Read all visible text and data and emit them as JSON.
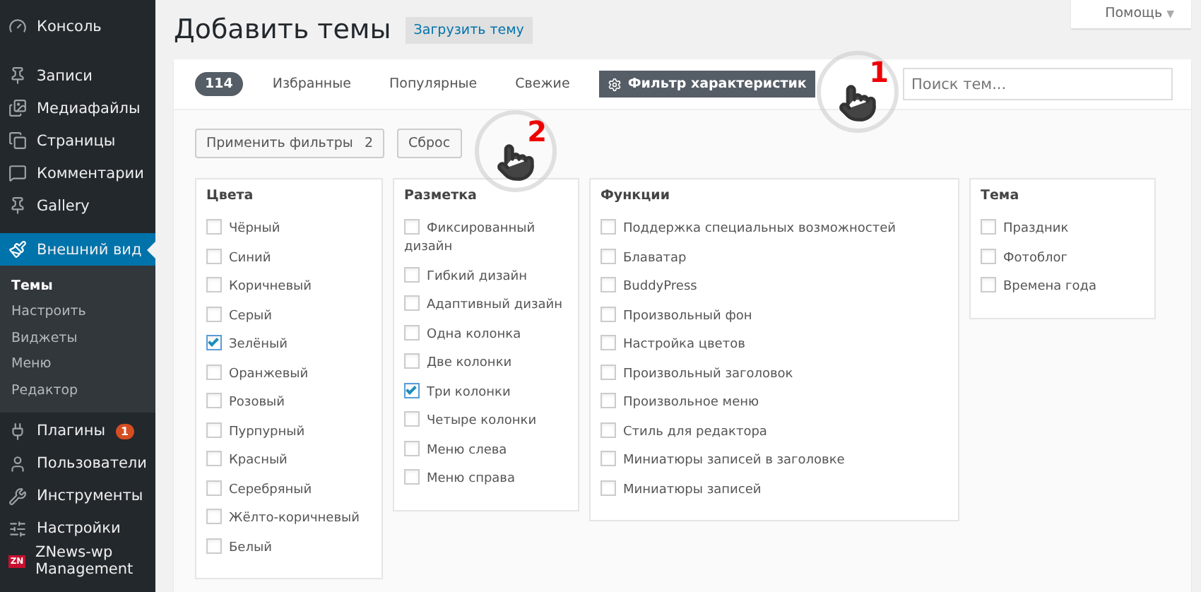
{
  "sidebar": {
    "items": [
      {
        "label": "Консоль",
        "selected": false
      },
      {
        "label": "Записи",
        "selected": false
      },
      {
        "label": "Медиафайлы",
        "selected": false
      },
      {
        "label": "Страницы",
        "selected": false
      },
      {
        "label": "Комментарии",
        "selected": false
      },
      {
        "label": "Gallery",
        "selected": false
      },
      {
        "label": "Внешний вид",
        "selected": true,
        "children": [
          {
            "label": "Темы",
            "selected": true
          },
          {
            "label": "Настроить",
            "selected": false
          },
          {
            "label": "Виджеты",
            "selected": false
          },
          {
            "label": "Меню",
            "selected": false
          },
          {
            "label": "Редактор",
            "selected": false
          }
        ]
      },
      {
        "label": "Плагины",
        "selected": false,
        "badge": "1"
      },
      {
        "label": "Пользователи",
        "selected": false
      },
      {
        "label": "Инструменты",
        "selected": false
      },
      {
        "label": "Настройки",
        "selected": false
      },
      {
        "label": "ZNews-wp Management",
        "selected": false,
        "logo_text": "ZN"
      }
    ]
  },
  "help_button": "Помощь",
  "help_caret": "▼",
  "page_title": "Добавить темы",
  "upload_button": "Загрузить тему",
  "filter_bar": {
    "count": "114",
    "tabs": [
      {
        "label": "Избранные",
        "selected": false
      },
      {
        "label": "Популярные",
        "selected": false
      },
      {
        "label": "Свежие",
        "selected": false
      },
      {
        "label": "Фильтр характеристик",
        "selected": true
      }
    ],
    "search": {
      "placeholder": "Поиск тем..."
    }
  },
  "apply_button": {
    "label": "Применить фильтры",
    "count": "2"
  },
  "reset_button": "Сброс",
  "filter_groups": [
    {
      "title": "Цвета",
      "options": [
        {
          "label": "Чёрный",
          "checked": false
        },
        {
          "label": "Синий",
          "checked": false
        },
        {
          "label": "Коричневый",
          "checked": false
        },
        {
          "label": "Серый",
          "checked": false
        },
        {
          "label": "Зелёный",
          "checked": true
        },
        {
          "label": "Оранжевый",
          "checked": false
        },
        {
          "label": "Розовый",
          "checked": false
        },
        {
          "label": "Пурпурный",
          "checked": false
        },
        {
          "label": "Красный",
          "checked": false
        },
        {
          "label": "Серебряный",
          "checked": false
        },
        {
          "label": "Жёлто-коричневый",
          "checked": false
        },
        {
          "label": "Белый",
          "checked": false
        }
      ]
    },
    {
      "title": "Разметка",
      "options": [
        {
          "label": "Фиксированный дизайн",
          "checked": false
        },
        {
          "label": "Гибкий дизайн",
          "checked": false
        },
        {
          "label": "Адаптивный дизайн",
          "checked": false
        },
        {
          "label": "Одна колонка",
          "checked": false
        },
        {
          "label": "Две колонки",
          "checked": false
        },
        {
          "label": "Три колонки",
          "checked": true
        },
        {
          "label": "Четыре колонки",
          "checked": false
        },
        {
          "label": "Меню слева",
          "checked": false
        },
        {
          "label": "Меню справа",
          "checked": false
        }
      ]
    },
    {
      "title": "Функции",
      "options": [
        {
          "label": "Поддержка специальных возможностей",
          "checked": false
        },
        {
          "label": "Блаватар",
          "checked": false
        },
        {
          "label": "BuddyPress",
          "checked": false
        },
        {
          "label": "Произвольный фон",
          "checked": false
        },
        {
          "label": "Настройка цветов",
          "checked": false
        },
        {
          "label": "Произвольный заголовок",
          "checked": false
        },
        {
          "label": "Произвольное меню",
          "checked": false
        },
        {
          "label": "Стиль для редактора",
          "checked": false
        },
        {
          "label": "Миниатюры записей в заголовке",
          "checked": false
        },
        {
          "label": "Миниатюры записей",
          "checked": false
        }
      ]
    },
    {
      "title": "Тема",
      "options": [
        {
          "label": "Праздник",
          "checked": false
        },
        {
          "label": "Фотоблог",
          "checked": false
        },
        {
          "label": "Времена года",
          "checked": false
        }
      ]
    }
  ],
  "annotations": [
    "1",
    "2"
  ]
}
